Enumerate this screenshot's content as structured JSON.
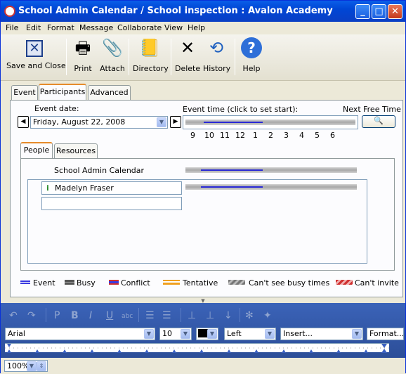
{
  "window": {
    "title": "School Admin Calendar / School inspection : Avalon Academy"
  },
  "menu": [
    "File",
    "Edit",
    "Format",
    "Message",
    "Collaborate",
    "View",
    "Help"
  ],
  "toolbar": {
    "save_close": "Save and Close",
    "print": "Print",
    "attach": "Attach",
    "directory": "Directory",
    "delete": "Delete",
    "history": "History",
    "help": "Help"
  },
  "tabs": [
    "Event",
    "Participants",
    "Advanced"
  ],
  "active_tab": "Participants",
  "event": {
    "date_label": "Event date:",
    "date_value": "Friday, August 22, 2008",
    "time_label": "Event time (click to set start):",
    "next_free": "Next Free Time",
    "hours": [
      "9",
      "10",
      "11",
      "12",
      "1",
      "2",
      "3",
      "4",
      "5",
      "6"
    ]
  },
  "subtabs": [
    "People",
    "Resources"
  ],
  "active_subtab": "People",
  "calendar_name": "School Admin Calendar",
  "participants": [
    "Madelyn Fraser"
  ],
  "legend": [
    {
      "label": "Event",
      "color": "#3a3ae0"
    },
    {
      "label": "Busy",
      "color": "#555555"
    },
    {
      "label": "Conflict",
      "color": "#d03030"
    },
    {
      "label": "Tentative",
      "color": "#f0a020"
    },
    {
      "label": "Can't see busy times",
      "color": "#909090"
    },
    {
      "label": "Can't invite",
      "color": "#d03030"
    }
  ],
  "format": {
    "font": "Arial",
    "size": "10",
    "align": "Left",
    "insert": "Insert...",
    "format_btn": "Format..."
  },
  "status": {
    "zoom": "100%"
  }
}
